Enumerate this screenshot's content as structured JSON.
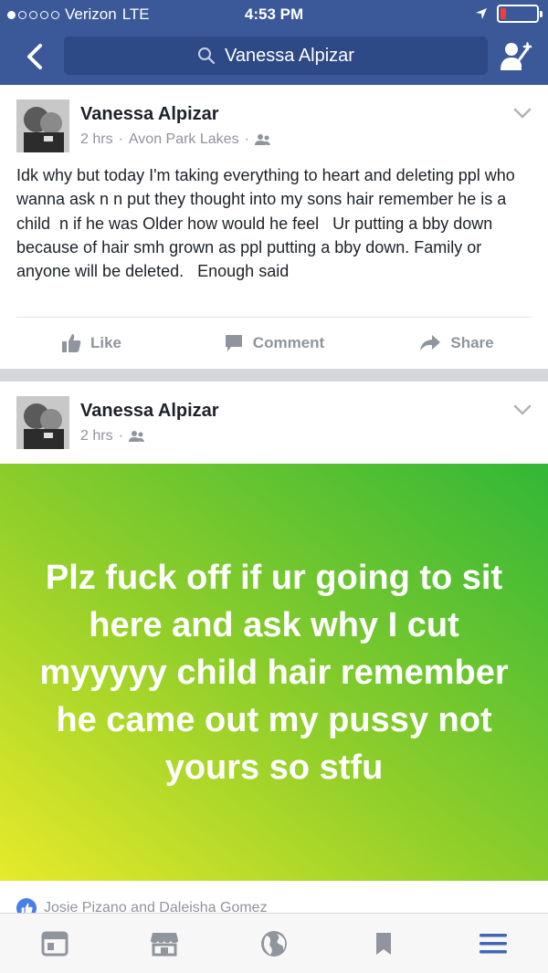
{
  "status": {
    "carrier": "Verizon",
    "network": "LTE",
    "time": "4:53 PM"
  },
  "search": {
    "query": "Vanessa Alpizar"
  },
  "post1": {
    "author": "Vanessa Alpizar",
    "time": "2 hrs",
    "location": "Avon Park Lakes",
    "text": "Idk why but today I'm taking everything to heart and deleting ppl who wanna ask n n put they thought into my sons hair remember he is a child  n if he was Older how would he feel   Ur putting a bby down because of hair smh grown as ppl putting a bby down. Family or anyone will be deleted.   Enough said",
    "actions": {
      "like": "Like",
      "comment": "Comment",
      "share": "Share"
    }
  },
  "post2": {
    "author": "Vanessa Alpizar",
    "time": "2 hrs",
    "text": "Plz fuck off if ur going to sit here and ask why I cut myyyyy child hair remember he came out my pussy not yours  so stfu",
    "reactions": "Josie Pizano and Daleisha Gomez"
  },
  "colors": {
    "brand": "#3b5998",
    "tab_active": "#4267b2",
    "tab_inactive": "#90949c"
  },
  "tabs": [
    "news-feed-icon",
    "marketplace-icon",
    "globe-icon",
    "bookmark-icon",
    "menu-icon"
  ]
}
